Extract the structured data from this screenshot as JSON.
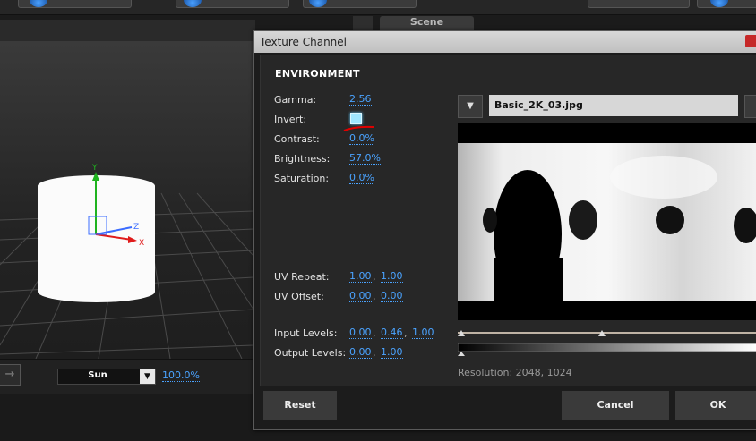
{
  "scene_tab": "Scene",
  "viewport": {
    "axis_y": "Y",
    "axis_z": "Z",
    "axis_x": "X",
    "light_select": "Sun",
    "light_percent": "100.0%"
  },
  "dialog": {
    "title": "Texture Channel",
    "section": "ENVIRONMENT",
    "gamma_label": "Gamma:",
    "gamma_value": "2.56",
    "invert_label": "Invert:",
    "contrast_label": "Contrast:",
    "contrast_value": "0.0%",
    "brightness_label": "Brightness:",
    "brightness_value": "57.0%",
    "saturation_label": "Saturation:",
    "saturation_value": "0.0%",
    "uv_repeat_label": "UV Repeat:",
    "uv_repeat": [
      "1.00",
      "1.00"
    ],
    "uv_offset_label": "UV Offset:",
    "uv_offset": [
      "0.00",
      "0.00"
    ],
    "input_levels_label": "Input Levels:",
    "input_levels": [
      "0.00",
      "0.46",
      "1.00"
    ],
    "output_levels_label": "Output Levels:",
    "output_levels": [
      "0.00",
      "1.00"
    ],
    "filename": "Basic_2K_03.jpg",
    "resolution": "Resolution: 2048, 1024",
    "reset_label": "Reset",
    "cancel_label": "Cancel",
    "ok_label": "OK",
    "comma": ","
  },
  "colors": {
    "accent": "#4aa3ff",
    "invert_on": "#9fe6ff",
    "annotation": "#e00000"
  }
}
